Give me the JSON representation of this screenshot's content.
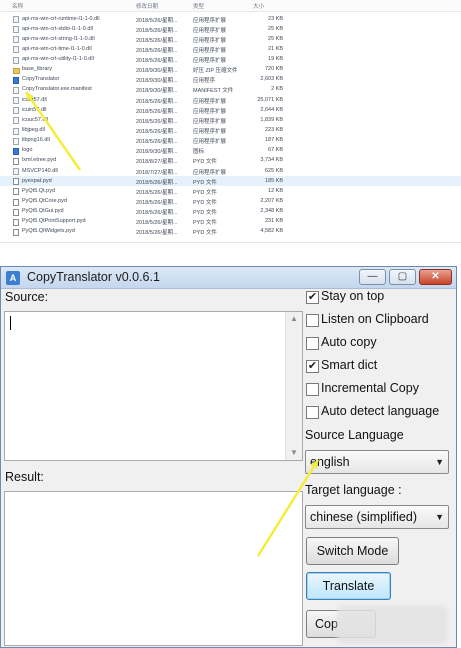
{
  "explorer": {
    "headers": {
      "name": "名称",
      "date": "修改日期",
      "type": "类型",
      "size": "大小"
    },
    "rows": [
      {
        "name": "api-ms-win-crt-runtime-l1-1-0.dll",
        "date": "2018/5/26/星期...",
        "type": "应用程序扩展",
        "size": "23 KB",
        "kind": "dll"
      },
      {
        "name": "api-ms-win-crt-stdio-l1-1-0.dll",
        "date": "2018/5/26/星期...",
        "type": "应用程序扩展",
        "size": "25 KB",
        "kind": "dll"
      },
      {
        "name": "api-ms-win-crt-string-l1-1-0.dll",
        "date": "2018/5/26/星期...",
        "type": "应用程序扩展",
        "size": "25 KB",
        "kind": "dll"
      },
      {
        "name": "api-ms-win-crt-time-l1-1-0.dll",
        "date": "2018/5/26/星期...",
        "type": "应用程序扩展",
        "size": "21 KB",
        "kind": "dll"
      },
      {
        "name": "api-ms-win-crt-utility-l1-1-0.dll",
        "date": "2018/5/26/星期...",
        "type": "应用程序扩展",
        "size": "19 KB",
        "kind": "dll"
      },
      {
        "name": "base_library",
        "date": "2018/9/30/星期...",
        "type": "好压 ZIP 压缩文件",
        "size": "720 KB",
        "kind": "zip"
      },
      {
        "name": "CopyTranslator",
        "date": "2018/9/30/星期...",
        "type": "应用程序",
        "size": "2,603 KB",
        "kind": "exe"
      },
      {
        "name": "CopyTranslator.exe.manifest",
        "date": "2018/9/30/星期...",
        "type": "MANIFEST 文件",
        "size": "2 KB",
        "kind": "file"
      },
      {
        "name": "icudt57.dll",
        "date": "2018/5/26/星期...",
        "type": "应用程序扩展",
        "size": "25,071 KB",
        "kind": "dll"
      },
      {
        "name": "icuin57.dll",
        "date": "2018/5/26/星期...",
        "type": "应用程序扩展",
        "size": "2,644 KB",
        "kind": "dll"
      },
      {
        "name": "icuuc57.dll",
        "date": "2018/5/26/星期...",
        "type": "应用程序扩展",
        "size": "1,839 KB",
        "kind": "dll"
      },
      {
        "name": "libjpeg.dll",
        "date": "2018/5/26/星期...",
        "type": "应用程序扩展",
        "size": "223 KB",
        "kind": "dll"
      },
      {
        "name": "libpng16.dll",
        "date": "2018/5/26/星期...",
        "type": "应用程序扩展",
        "size": "187 KB",
        "kind": "dll"
      },
      {
        "name": "logo",
        "date": "2018/9/30/星期...",
        "type": "图标",
        "size": "67 KB",
        "kind": "ico"
      },
      {
        "name": "lxml.etree.pyd",
        "date": "2018/8/27/星期...",
        "type": "PYD 文件",
        "size": "3,734 KB",
        "kind": "pyd"
      },
      {
        "name": "MSVCP140.dll",
        "date": "2018/7/27/星期...",
        "type": "应用程序扩展",
        "size": "625 KB",
        "kind": "dll"
      },
      {
        "name": "pyexpat.pyd",
        "date": "2018/5/26/星期...",
        "type": "PYD 文件",
        "size": "185 KB",
        "kind": "pyd"
      },
      {
        "name": "PyQt5.Qt.pyd",
        "date": "2018/5/26/星期...",
        "type": "PYD 文件",
        "size": "12 KB",
        "kind": "pyd"
      },
      {
        "name": "PyQt5.QtCore.pyd",
        "date": "2018/5/26/星期...",
        "type": "PYD 文件",
        "size": "2,207 KB",
        "kind": "pyd"
      },
      {
        "name": "PyQt5.QtGui.pyd",
        "date": "2018/5/26/星期...",
        "type": "PYD 文件",
        "size": "2,348 KB",
        "kind": "pyd"
      },
      {
        "name": "PyQt5.QtPrintSupport.pyd",
        "date": "2018/5/26/星期...",
        "type": "PYD 文件",
        "size": "231 KB",
        "kind": "pyd"
      },
      {
        "name": "PyQt5.QtWidgets.pyd",
        "date": "2018/5/26/星期...",
        "type": "PYD 文件",
        "size": "4,582 KB",
        "kind": "pyd"
      }
    ],
    "selected_row": "pyexpat.pyd"
  },
  "window": {
    "title": "CopyTranslator v0.0.6.1",
    "minimize_icon": "minimize-icon",
    "maximize_icon": "maximize-icon",
    "close_icon": "close-icon",
    "source_label": "Source:",
    "source_value": "",
    "result_label": "Result:",
    "result_value": "",
    "options": [
      {
        "label": "Stay on top",
        "checked": true
      },
      {
        "label": "Listen on Clipboard",
        "checked": false
      },
      {
        "label": "Auto copy",
        "checked": false
      },
      {
        "label": "Smart dict",
        "checked": true
      },
      {
        "label": "Incremental Copy",
        "checked": false
      },
      {
        "label": "Auto detect language",
        "checked": false
      }
    ],
    "source_language_label": "Source Language",
    "source_language_value": "english",
    "target_language_label": "Target language :",
    "target_language_value": "chinese (simplified)",
    "switch_mode_label": "Switch Mode",
    "translate_label": "Translate",
    "copy_label_visible": "Cop"
  },
  "annotation": {
    "arrow_color": "#f3ee3c"
  }
}
